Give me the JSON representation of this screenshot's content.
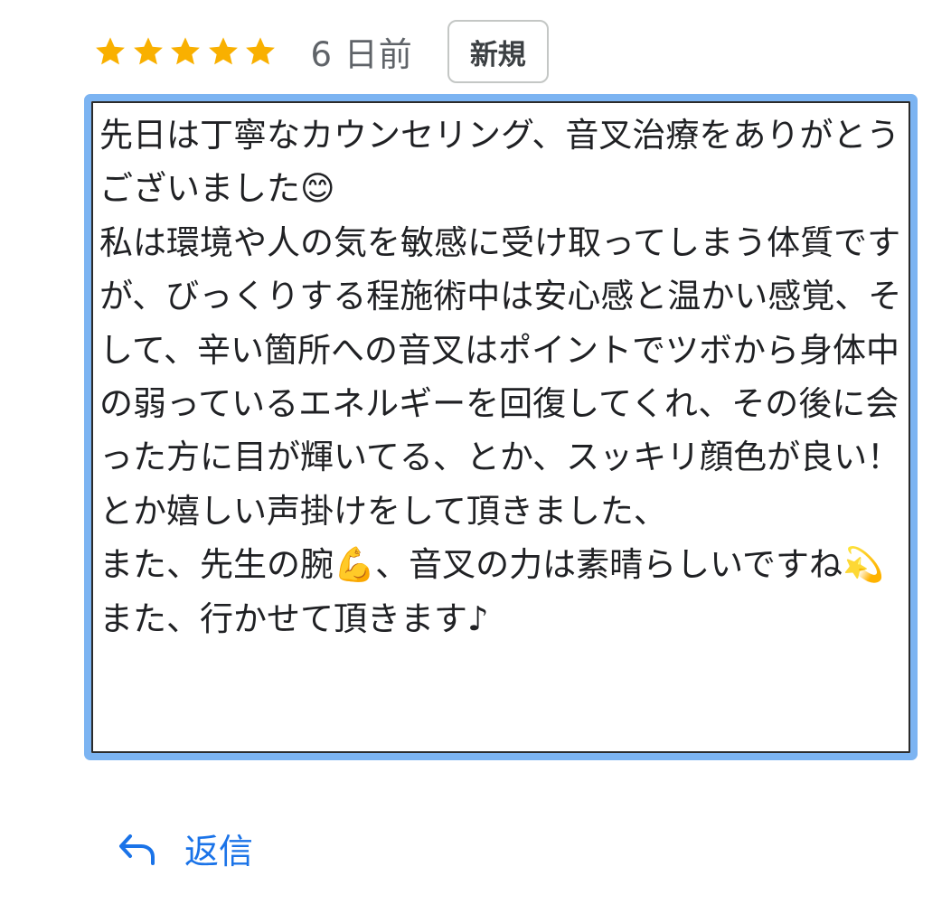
{
  "review": {
    "rating": 5,
    "rating_max": 5,
    "star_color": "#f9b000",
    "time": "6 日前",
    "badge": "新規",
    "text": "先日は丁寧なカウンセリング、音叉治療をありがとうございました😊\n私は環境や人の気を敏感に受け取ってしまう体質ですが、びっくりする程施術中は安心感と温かい感覚、そして、辛い箇所への音叉はポイントでツボから身体中の弱っているエネルギーを回復してくれ、その後に会った方に目が輝いてる、とか、スッキリ顔色が良い！とか嬉しい声掛けをして頂きました、\nまた、先生の腕💪、音叉の力は素晴らしいですね💫\nまた、行かせて頂きます♪",
    "highlight_color": "#7cb4f2"
  },
  "actions": {
    "reply_label": "返信",
    "reply_icon": "reply-arrow-icon",
    "accent_color": "#1a73e8"
  }
}
